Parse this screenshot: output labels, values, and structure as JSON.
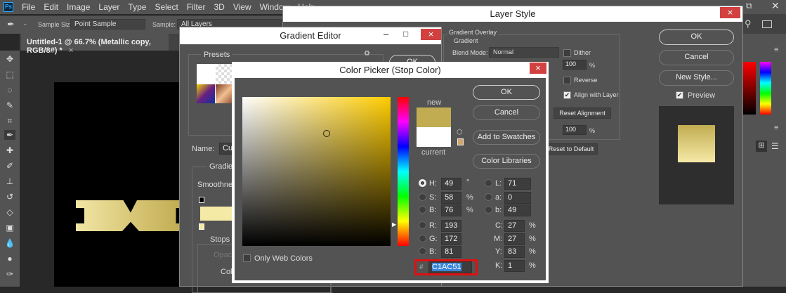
{
  "menubar": {
    "logo": "Ps",
    "items": [
      "File",
      "Edit",
      "Image",
      "Layer",
      "Type",
      "Select",
      "Filter",
      "3D",
      "View",
      "Window",
      "Help"
    ]
  },
  "options": {
    "sample_size_label": "Sample Size:",
    "sample_size_value": "Point Sample",
    "sample_label": "Sample:",
    "sample_value": "All Layers"
  },
  "document": {
    "tab_title": "Untitled-1 @ 66.7% (Metallic copy, RGB/8#) *",
    "close": "×"
  },
  "layer_style": {
    "title": "Layer Style",
    "section": "Gradient Overlay",
    "subsection": "Gradient",
    "blend_mode_label": "Blend Mode:",
    "blend_mode_value": "Normal",
    "dither_label": "Dither",
    "opacity_value": "100",
    "opacity_unit": "%",
    "reverse_label": "Reverse",
    "align_label": "Align with Layer",
    "reset_alignment": "Reset Alignment",
    "scale_value": "100",
    "scale_unit": "%",
    "reset_default": "Reset to Default",
    "ok": "OK",
    "cancel": "Cancel",
    "new_style": "New Style...",
    "preview_label": "Preview",
    "close": "×"
  },
  "gradient_editor": {
    "title": "Gradient Editor",
    "presets_label": "Presets",
    "name_label": "Name:",
    "name_value": "Custom",
    "gradient_type_label": "Gradient Type",
    "smoothness_label": "Smoothness",
    "stops_label": "Stops",
    "opacity_label": "Opacity",
    "color_label": "Color",
    "ok": "OK",
    "close": "×",
    "minimize": "–",
    "maximize": "□"
  },
  "color_picker": {
    "title": "Color Picker (Stop Color)",
    "new_label": "new",
    "current_label": "current",
    "new_color": "#C1AC51",
    "current_color": "#FFFFFF",
    "ok": "OK",
    "cancel": "Cancel",
    "add_swatches": "Add to Swatches",
    "color_libraries": "Color Libraries",
    "only_web_colors": "Only Web Colors",
    "close": "×",
    "fields": {
      "H": "49",
      "S": "58",
      "B": "76",
      "R": "193",
      "G": "172",
      "B2": "81",
      "L": "71",
      "a": "0",
      "b": "49",
      "C": "27",
      "M": "27",
      "Y": "83",
      "K": "1"
    },
    "units": {
      "deg": "°",
      "pct": "%"
    },
    "labels": {
      "H": "H:",
      "S": "S:",
      "B": "B:",
      "R": "R:",
      "G": "G:",
      "B2": "B:",
      "L": "L:",
      "a": "a:",
      "b": "b:",
      "C": "C:",
      "M": "M:",
      "Y": "Y:",
      "K": "K:",
      "hash": "#"
    },
    "hex": "C1AC51"
  }
}
